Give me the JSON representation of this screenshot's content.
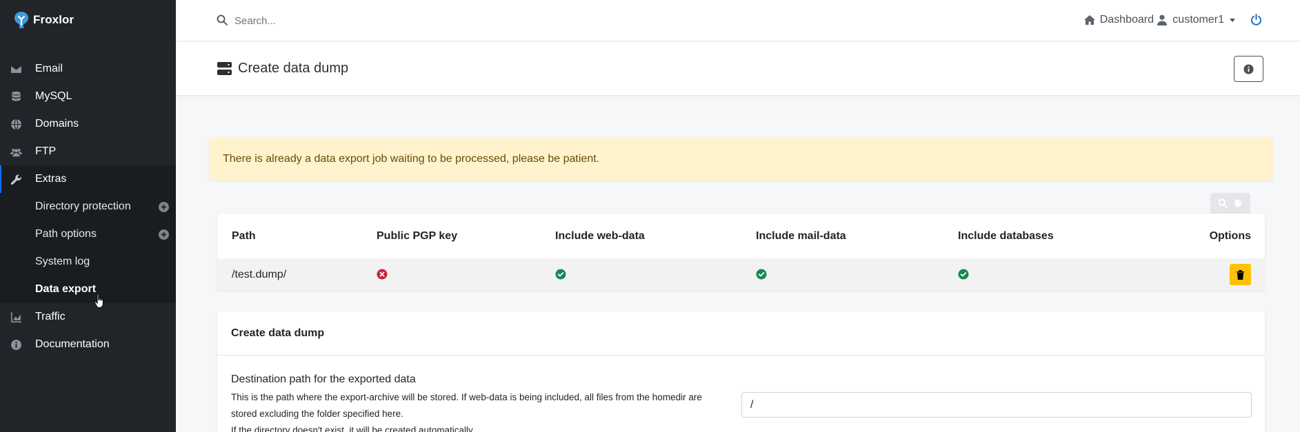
{
  "brand": {
    "name": "Froxlor"
  },
  "sidebar": {
    "items": [
      {
        "label": "Email",
        "icon": "envelope-icon"
      },
      {
        "label": "MySQL",
        "icon": "database-icon"
      },
      {
        "label": "Domains",
        "icon": "globe-icon"
      },
      {
        "label": "FTP",
        "icon": "users-icon"
      },
      {
        "label": "Extras",
        "icon": "wrench-icon",
        "active": true
      },
      {
        "label": "Traffic",
        "icon": "chart-icon"
      },
      {
        "label": "Documentation",
        "icon": "info-icon"
      }
    ],
    "extras_sub": [
      {
        "label": "Directory protection",
        "has_add": true
      },
      {
        "label": "Path options",
        "has_add": true
      },
      {
        "label": "System log",
        "has_add": false
      },
      {
        "label": "Data export",
        "has_add": false,
        "current": true
      }
    ]
  },
  "topbar": {
    "search_placeholder": "Search...",
    "dashboard_label": "Dashboard",
    "user_label": "customer1"
  },
  "page": {
    "title": "Create data dump"
  },
  "alert": {
    "text": "There is already a data export job waiting to be processed, please be patient."
  },
  "table": {
    "headers": [
      "Path",
      "Public PGP key",
      "Include web-data",
      "Include mail-data",
      "Include databases",
      "Options"
    ],
    "rows": [
      {
        "path": "/test.dump/",
        "pgp": false,
        "web": true,
        "mail": true,
        "db": true
      }
    ]
  },
  "form": {
    "title": "Create data dump",
    "field_label": "Destination path for the exported data",
    "help_lines": [
      "This is the path where the export-archive will be stored. If web-data is being included, all files from the homedir are",
      "stored excluding the folder specified here.",
      "If the directory doesn't exist, it will be created automatically."
    ],
    "path_value": "/"
  },
  "colors": {
    "sidebar_bg": "#212529",
    "warning_bg": "#fff3cd",
    "success": "#198754",
    "danger": "#dc3545",
    "delete_button": "#ffc107"
  }
}
